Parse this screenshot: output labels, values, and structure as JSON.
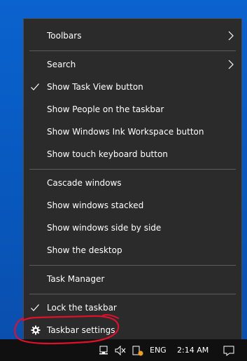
{
  "context_menu": {
    "items": [
      {
        "label": "Toolbars",
        "has_submenu": true,
        "checked": false
      },
      {
        "label": "Search",
        "has_submenu": true,
        "checked": false
      },
      {
        "label": "Show Task View button",
        "has_submenu": false,
        "checked": true
      },
      {
        "label": "Show People on the taskbar",
        "has_submenu": false,
        "checked": false
      },
      {
        "label": "Show Windows Ink Workspace button",
        "has_submenu": false,
        "checked": false
      },
      {
        "label": "Show touch keyboard button",
        "has_submenu": false,
        "checked": false
      },
      {
        "label": "Cascade windows",
        "has_submenu": false,
        "checked": false
      },
      {
        "label": "Show windows stacked",
        "has_submenu": false,
        "checked": false
      },
      {
        "label": "Show windows side by side",
        "has_submenu": false,
        "checked": false
      },
      {
        "label": "Show the desktop",
        "has_submenu": false,
        "checked": false
      },
      {
        "label": "Task Manager",
        "has_submenu": false,
        "checked": false
      },
      {
        "label": "Lock the taskbar",
        "has_submenu": false,
        "checked": true
      },
      {
        "label": "Taskbar settings",
        "has_submenu": false,
        "checked": false,
        "icon": "gear-icon"
      }
    ]
  },
  "taskbar": {
    "language": "ENG",
    "time": "2:14 AM"
  },
  "colors": {
    "menu_background": "#2b2b2b",
    "desktop_blue": "#0858be",
    "annotation_red": "#e0102a"
  }
}
